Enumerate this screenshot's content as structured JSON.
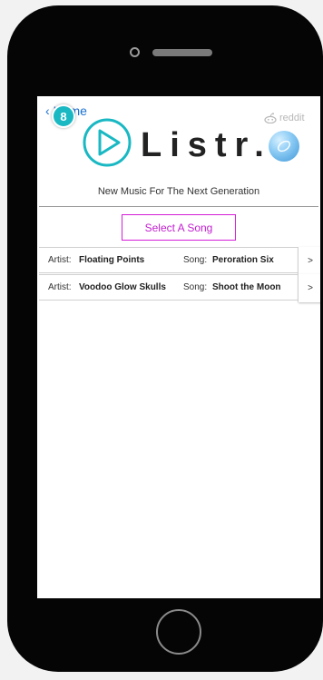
{
  "header": {
    "back_label": "Home",
    "badge_count": "8",
    "reddit_label": "reddit",
    "app_name": "Listr.",
    "tagline": "New Music For The Next Generation"
  },
  "actions": {
    "select_song_label": "Select A Song"
  },
  "songs": [
    {
      "artist_prefix": "Artist:",
      "artist": "Floating Points",
      "song_prefix": "Song:",
      "song": "Peroration Six",
      "go": ">"
    },
    {
      "artist_prefix": "Artist:",
      "artist": "Voodoo Glow Skulls",
      "song_prefix": "Song:",
      "song": "Shoot the Moon",
      "go": ">"
    }
  ],
  "colors": {
    "accent_teal": "#19b8c3",
    "select_magenta": "#c21fd0",
    "reddit_gray": "#b7b7b7"
  },
  "icons": [
    "play-icon",
    "reddit-alien-icon",
    "app-icon",
    "chevron-left-icon"
  ]
}
